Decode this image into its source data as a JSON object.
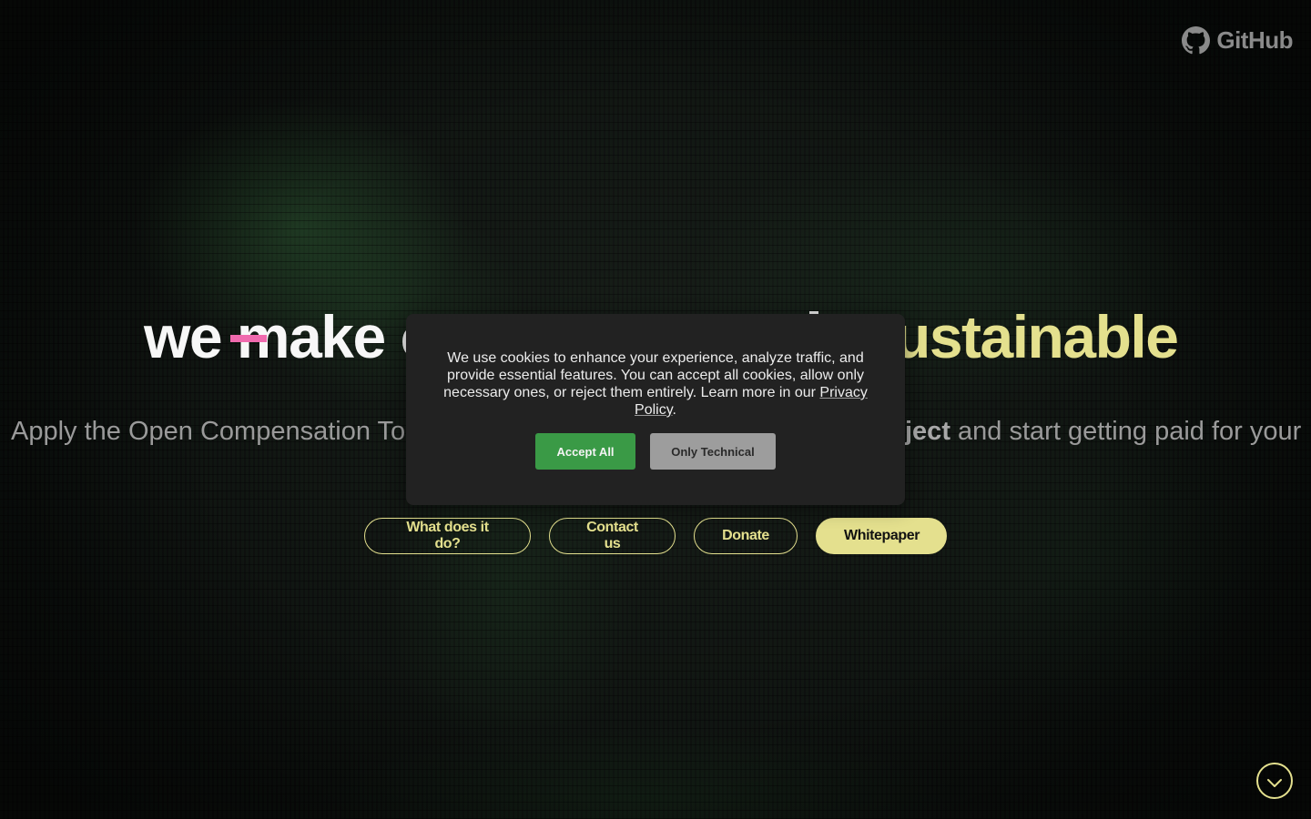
{
  "header": {
    "github_label": "GitHub"
  },
  "hero": {
    "title": {
      "prefix": "we make ",
      "struck_fragment": "o",
      "highlight_fragment": "ustainable"
    },
    "subtitle": {
      "left_fragment": "Apply the Open Compensation Tok",
      "bold_fragment": "ject",
      "right_fragment": " and start getting paid for your"
    },
    "buttons": [
      {
        "label": "What does it do?",
        "style": "outline"
      },
      {
        "label": "Contact us",
        "style": "outline"
      },
      {
        "label": "Donate",
        "style": "outline"
      },
      {
        "label": "Whitepaper",
        "style": "filled"
      }
    ]
  },
  "cookie_banner": {
    "message": "We use cookies to enhance your experience, analyze traffic, and provide essential features. You can accept all cookies, allow only necessary ones, or reject them entirely. Learn more in our ",
    "link_label": "Privacy Policy",
    "message_end": ".",
    "accept_label": "Accept All",
    "technical_label": "Only Technical"
  },
  "colors": {
    "accent_yellow": "#e4e08e",
    "strike_pink": "#f06aae",
    "accept_green": "#3a9a46",
    "modal_bg": "#222222"
  },
  "icons": {
    "github": "github-icon",
    "scroll": "chevron-down-icon"
  }
}
